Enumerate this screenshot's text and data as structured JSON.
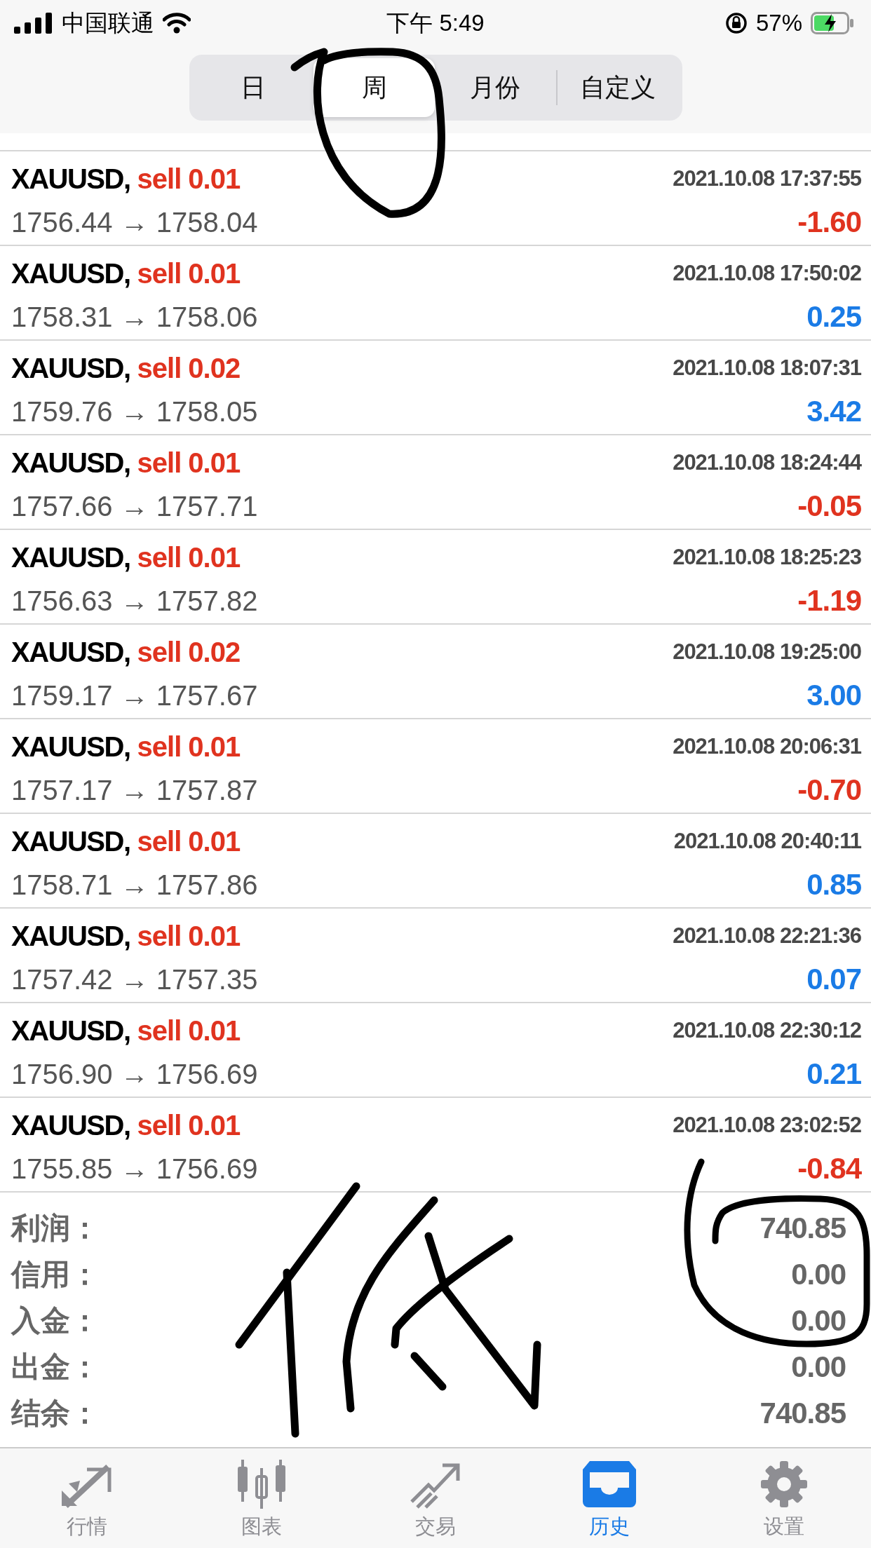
{
  "status_bar": {
    "carrier": "中国联通",
    "time": "下午 5:49",
    "battery": "57%"
  },
  "period_tabs": [
    {
      "label": "日",
      "selected": false
    },
    {
      "label": "周",
      "selected": true
    },
    {
      "label": "月份",
      "selected": false
    },
    {
      "label": "自定义",
      "selected": false
    }
  ],
  "trades": [
    {
      "symbol": "XAUUSD,",
      "side": "sell 0.01",
      "time": "2021.10.08 17:37:55",
      "prices": "1756.44 → 1758.04",
      "profit": "-1.60",
      "kind": "loss"
    },
    {
      "symbol": "XAUUSD,",
      "side": "sell 0.01",
      "time": "2021.10.08 17:50:02",
      "prices": "1758.31 → 1758.06",
      "profit": "0.25",
      "kind": "gain"
    },
    {
      "symbol": "XAUUSD,",
      "side": "sell 0.02",
      "time": "2021.10.08 18:07:31",
      "prices": "1759.76 → 1758.05",
      "profit": "3.42",
      "kind": "gain"
    },
    {
      "symbol": "XAUUSD,",
      "side": "sell 0.01",
      "time": "2021.10.08 18:24:44",
      "prices": "1757.66 → 1757.71",
      "profit": "-0.05",
      "kind": "loss"
    },
    {
      "symbol": "XAUUSD,",
      "side": "sell 0.01",
      "time": "2021.10.08 18:25:23",
      "prices": "1756.63 → 1757.82",
      "profit": "-1.19",
      "kind": "loss"
    },
    {
      "symbol": "XAUUSD,",
      "side": "sell 0.02",
      "time": "2021.10.08 19:25:00",
      "prices": "1759.17 → 1757.67",
      "profit": "3.00",
      "kind": "gain"
    },
    {
      "symbol": "XAUUSD,",
      "side": "sell 0.01",
      "time": "2021.10.08 20:06:31",
      "prices": "1757.17 → 1757.87",
      "profit": "-0.70",
      "kind": "loss"
    },
    {
      "symbol": "XAUUSD,",
      "side": "sell 0.01",
      "time": "2021.10.08 20:40:11",
      "prices": "1758.71 → 1757.86",
      "profit": "0.85",
      "kind": "gain"
    },
    {
      "symbol": "XAUUSD,",
      "side": "sell 0.01",
      "time": "2021.10.08 22:21:36",
      "prices": "1757.42 → 1757.35",
      "profit": "0.07",
      "kind": "gain"
    },
    {
      "symbol": "XAUUSD,",
      "side": "sell 0.01",
      "time": "2021.10.08 22:30:12",
      "prices": "1756.90 → 1756.69",
      "profit": "0.21",
      "kind": "gain"
    },
    {
      "symbol": "XAUUSD,",
      "side": "sell 0.01",
      "time": "2021.10.08 23:02:52",
      "prices": "1755.85 → 1756.69",
      "profit": "-0.84",
      "kind": "loss"
    }
  ],
  "summary": [
    {
      "label": "利润：",
      "value": "740.85"
    },
    {
      "label": "信用：",
      "value": "0.00"
    },
    {
      "label": "入金：",
      "value": "0.00"
    },
    {
      "label": "出金：",
      "value": "0.00"
    },
    {
      "label": "结余：",
      "value": "740.85"
    }
  ],
  "tab_bar": [
    {
      "label": "行情",
      "kind": "quotes",
      "selected": false
    },
    {
      "label": "图表",
      "kind": "chart",
      "selected": false
    },
    {
      "label": "交易",
      "kind": "trade",
      "selected": false
    },
    {
      "label": "历史",
      "kind": "history",
      "selected": true
    },
    {
      "label": "设置",
      "kind": "settings",
      "selected": false
    }
  ]
}
